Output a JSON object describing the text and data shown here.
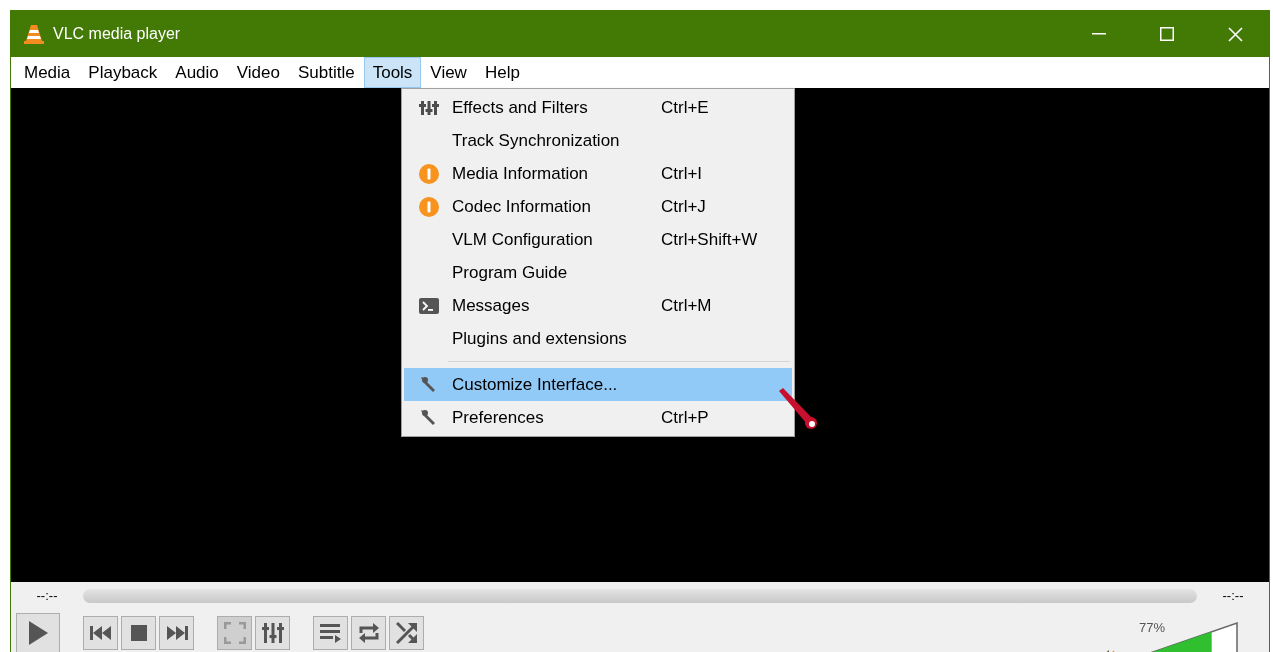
{
  "window": {
    "title": "VLC media player"
  },
  "menu_bar": [
    {
      "label": "Media",
      "selected": false
    },
    {
      "label": "Playback",
      "selected": false
    },
    {
      "label": "Audio",
      "selected": false
    },
    {
      "label": "Video",
      "selected": false
    },
    {
      "label": "Subtitle",
      "selected": false
    },
    {
      "label": "Tools",
      "selected": true
    },
    {
      "label": "View",
      "selected": false
    },
    {
      "label": "Help",
      "selected": false
    }
  ],
  "tools_menu": [
    {
      "kind": "filters",
      "label": "Effects and Filters",
      "shortcut": "Ctrl+E",
      "selected": false
    },
    {
      "kind": "plain",
      "label": "Track Synchronization",
      "selected": false
    },
    {
      "kind": "info",
      "label": "Media Information",
      "shortcut": "Ctrl+I",
      "selected": false
    },
    {
      "kind": "info",
      "label": "Codec Information",
      "shortcut": "Ctrl+J",
      "selected": false
    },
    {
      "kind": "plain",
      "label": "VLM Configuration",
      "shortcut": "Ctrl+Shift+W",
      "selected": false
    },
    {
      "kind": "plain",
      "label": "Program Guide",
      "selected": false
    },
    {
      "kind": "console",
      "label": "Messages",
      "shortcut": "Ctrl+M",
      "selected": false
    },
    {
      "kind": "plain",
      "label": "Plugins and extensions",
      "selected": false
    },
    {
      "kind": "separator"
    },
    {
      "kind": "wrench",
      "label": "Customize Interface...",
      "selected": true
    },
    {
      "kind": "wrench",
      "label": "Preferences",
      "shortcut": "Ctrl+P",
      "selected": false
    }
  ],
  "controls": {
    "elapsed": "--:--",
    "remaining": "--:--",
    "buttons": [
      {
        "kind": "play",
        "disabled": false
      },
      {
        "kind": "gap"
      },
      {
        "kind": "previous",
        "disabled": false
      },
      {
        "kind": "stop",
        "disabled": false
      },
      {
        "kind": "next",
        "disabled": false
      },
      {
        "kind": "gap"
      },
      {
        "kind": "fullscreen",
        "disabled": true
      },
      {
        "kind": "filters",
        "disabled": false
      },
      {
        "kind": "gap"
      },
      {
        "kind": "playlist",
        "disabled": false
      },
      {
        "kind": "loop",
        "disabled": false
      },
      {
        "kind": "shuffle",
        "disabled": false
      }
    ],
    "volume": {
      "reading": "77%",
      "level": 0.77
    }
  }
}
